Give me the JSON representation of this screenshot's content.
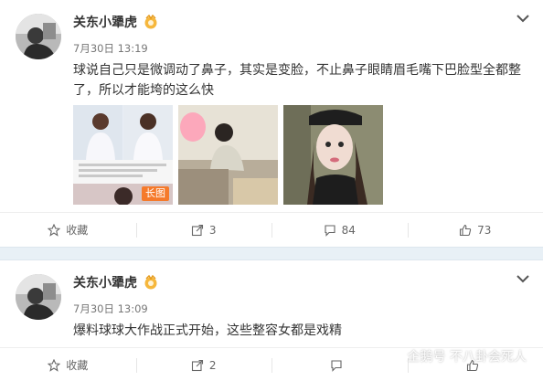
{
  "posts": [
    {
      "username": "关东小犟虎",
      "time": "7月30日 13:19",
      "text": "球说自己只是微调动了鼻子，其实是变脸，不止鼻子眼睛眉毛嘴下巴脸型全都整了，所以才能垮的这么快",
      "image_tag": "长图",
      "actions": {
        "favorite": "收藏",
        "share": "3",
        "comment": "84",
        "like": "73"
      }
    },
    {
      "username": "关东小犟虎",
      "time": "7月30日 13:09",
      "text": "爆料球球大作战正式开始，这些整容女都是戏精",
      "actions": {
        "favorite": "收藏",
        "share": "2",
        "comment": "",
        "like": ""
      }
    }
  ],
  "watermark": "企鹅号 不八卦会死人",
  "colors": {
    "accent": "#f57a2b",
    "separator": "#e8f0f6",
    "text": "#333333",
    "muted": "#777777"
  }
}
